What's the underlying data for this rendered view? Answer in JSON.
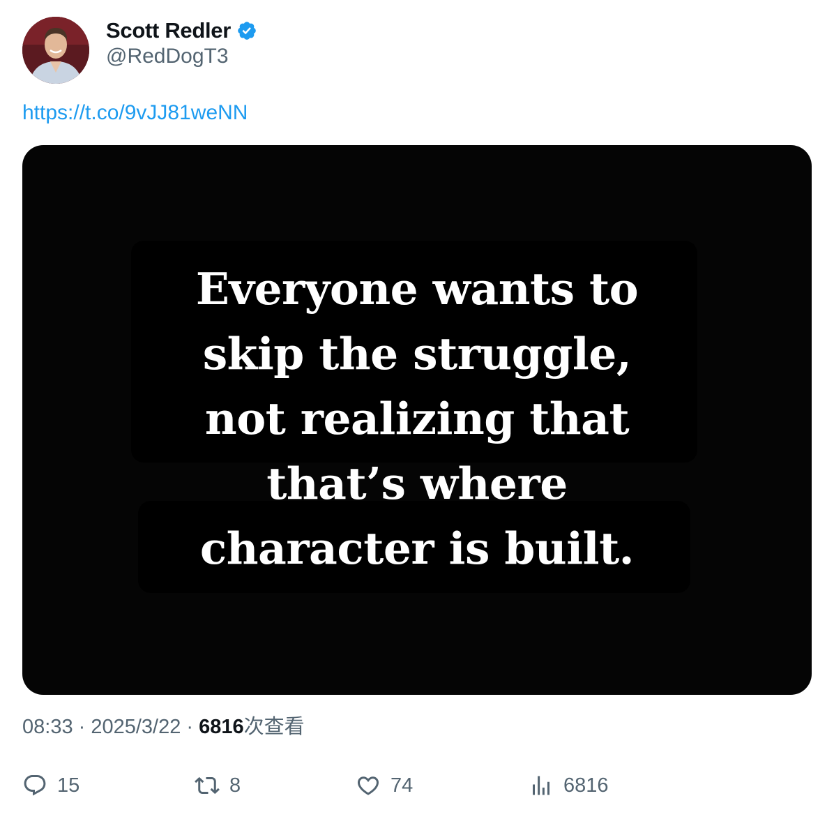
{
  "author": {
    "display_name": "Scott Redler",
    "handle": "@RedDogT3",
    "verified_icon": "verified-badge-icon",
    "brand_color": "#1d9bf0"
  },
  "tweet": {
    "link_text": "https://t.co/9vJJ81weNN",
    "image_quote": "Everyone wants to\nskip the struggle,\nnot realizing that\nthat’s where\ncharacter is built."
  },
  "meta": {
    "time": "08:33",
    "sep1": " · ",
    "date": "2025/3/22",
    "sep2": " · ",
    "views_count": "6816",
    "views_label": "次查看"
  },
  "actions": {
    "reply": {
      "icon": "reply-icon",
      "count": "15"
    },
    "retweet": {
      "icon": "retweet-icon",
      "count": "8"
    },
    "like": {
      "icon": "heart-icon",
      "count": "74"
    },
    "views": {
      "icon": "analytics-icon",
      "count": "6816"
    }
  },
  "colors": {
    "text_primary": "#0f1419",
    "text_secondary": "#536471",
    "link": "#1d9bf0",
    "image_background": "#050505"
  }
}
